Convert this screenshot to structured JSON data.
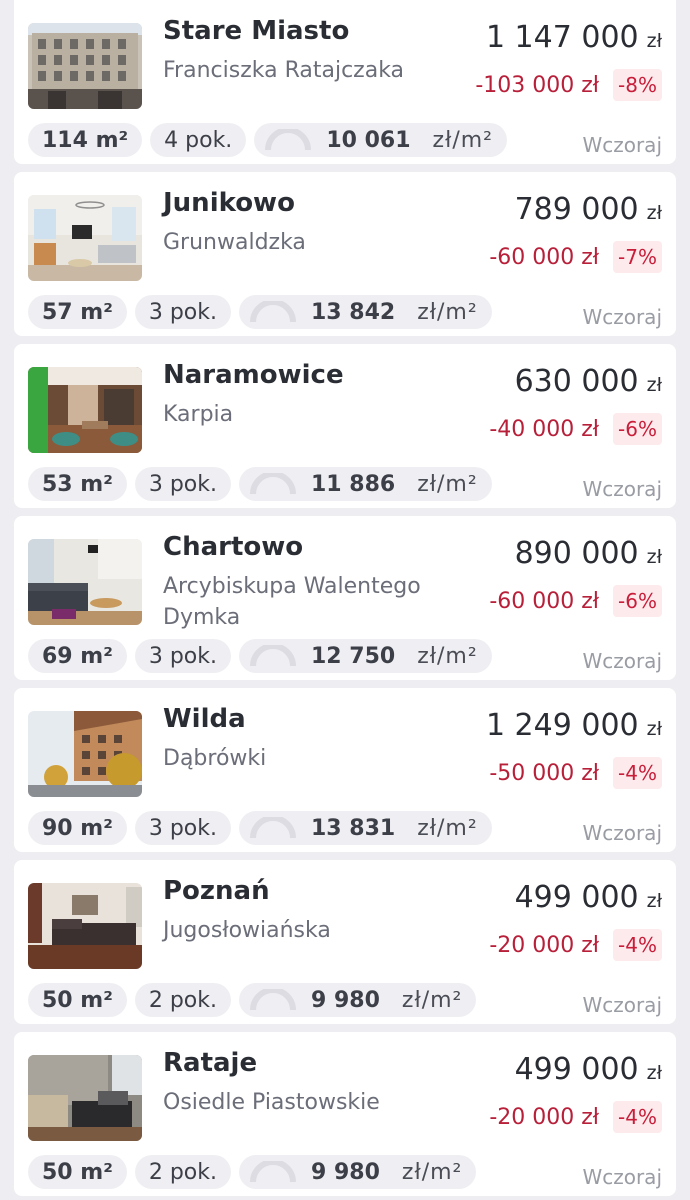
{
  "listings": [
    {
      "title": "Stare Miasto",
      "street": "Franciszka Ratajczaka",
      "price": "1 147 000",
      "currency": "zł",
      "drop": "-103 000 zł",
      "drop_pct": "-8%",
      "area": "114 m²",
      "rooms": "4 pok.",
      "price_per_m2": "10 061",
      "ppm_unit": "zł/m²",
      "date": "Wczoraj",
      "photo": "building-facade"
    },
    {
      "title": "Junikowo",
      "street": "Grunwaldzka",
      "price": "789 000",
      "currency": "zł",
      "drop": "-60 000 zł",
      "drop_pct": "-7%",
      "area": "57 m²",
      "rooms": "3 pok.",
      "price_per_m2": "13 842",
      "ppm_unit": "zł/m²",
      "date": "Wczoraj",
      "photo": "bright-living-room"
    },
    {
      "title": "Naramowice",
      "street": "Karpia",
      "price": "630 000",
      "currency": "zł",
      "drop": "-40 000 zł",
      "drop_pct": "-6%",
      "area": "53 m²",
      "rooms": "3 pok.",
      "price_per_m2": "11 886",
      "ppm_unit": "zł/m²",
      "date": "Wczoraj",
      "photo": "green-wall-dining"
    },
    {
      "title": "Chartowo",
      "street": "Arcybiskupa Walentego Dymka",
      "price": "890 000",
      "currency": "zł",
      "drop": "-60 000 zł",
      "drop_pct": "-6%",
      "area": "69 m²",
      "rooms": "3 pok.",
      "price_per_m2": "12 750",
      "ppm_unit": "zł/m²",
      "date": "Wczoraj",
      "photo": "sofa-living-room"
    },
    {
      "title": "Wilda",
      "street": "Dąbrówki",
      "price": "1 249 000",
      "currency": "zł",
      "drop": "-50 000 zł",
      "drop_pct": "-4%",
      "area": "90 m²",
      "rooms": "3 pok.",
      "price_per_m2": "13 831",
      "ppm_unit": "zł/m²",
      "date": "Wczoraj",
      "photo": "street-building"
    },
    {
      "title": "Poznań",
      "street": "Jugosłowiańska",
      "price": "499 000",
      "currency": "zł",
      "drop": "-20 000 zł",
      "drop_pct": "-4%",
      "area": "50 m²",
      "rooms": "2 pok.",
      "price_per_m2": "9 980",
      "ppm_unit": "zł/m²",
      "date": "Wczoraj",
      "photo": "dark-sofa-room"
    },
    {
      "title": "Rataje",
      "street": "Osiedle Piastowskie",
      "price": "499 000",
      "currency": "zł",
      "drop": "-20 000 zł",
      "drop_pct": "-4%",
      "area": "50 m²",
      "rooms": "2 pok.",
      "price_per_m2": "9 980",
      "ppm_unit": "zł/m²",
      "date": "Wczoraj",
      "photo": "wallpaper-room"
    }
  ],
  "colors": {
    "accent_red": "#b8203a",
    "badge_bg": "#fdeaec",
    "chip_bg": "#efeff3",
    "page_bg": "#eeeef2"
  }
}
